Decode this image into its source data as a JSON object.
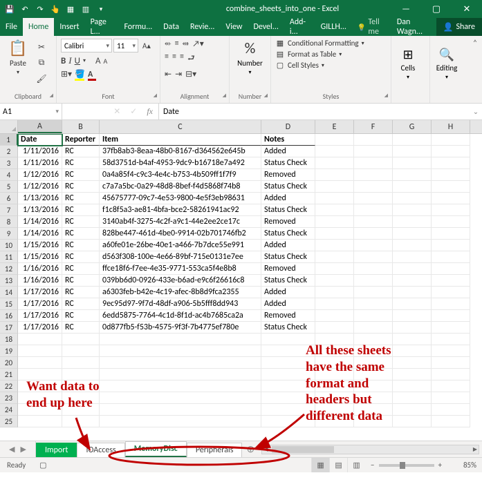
{
  "window": {
    "title": "combine_sheets_into_one - Excel",
    "user": "Dan Wagn...",
    "share_label": "Share"
  },
  "ribbon_tabs": [
    "File",
    "Home",
    "Insert",
    "Page L...",
    "Formu...",
    "Data",
    "Revie...",
    "View",
    "Devel...",
    "Add-i...",
    "GILLH..."
  ],
  "tell_me": "Tell me",
  "ribbon": {
    "paste": "Paste",
    "clipboard_label": "Clipboard",
    "font_name": "Calibri",
    "font_size": "11",
    "font_label": "Font",
    "alignment_label": "Alignment",
    "number": "Number",
    "number_label": "Number",
    "cond_fmt": "Conditional Formatting",
    "fmt_table": "Format as Table",
    "cell_styles": "Cell Styles",
    "styles_label": "Styles",
    "cells": "Cells",
    "editing": "Editing"
  },
  "namebox": "A1",
  "formula": "Date",
  "columns": [
    "A",
    "B",
    "C",
    "D",
    "E",
    "F",
    "G",
    "H"
  ],
  "headers": {
    "A": "Date",
    "B": "Reporter",
    "C": "Item",
    "D": "Notes"
  },
  "rows": [
    {
      "n": 2,
      "A": "1/11/2016",
      "B": "RC",
      "C": "37fb8ab3-8eaa-48b0-8167-d364562e645b",
      "D": "Added"
    },
    {
      "n": 3,
      "A": "1/11/2016",
      "B": "RC",
      "C": "58d3751d-b4af-4953-9dc9-b16718e7a492",
      "D": "Status Check"
    },
    {
      "n": 4,
      "A": "1/12/2016",
      "B": "RC",
      "C": "0a4a85f4-c9c3-4e4c-b753-4b509ff1f7f9",
      "D": "Removed"
    },
    {
      "n": 5,
      "A": "1/12/2016",
      "B": "RC",
      "C": "c7a7a5bc-0a29-48d8-8bef-f4d5868f74b8",
      "D": "Status Check"
    },
    {
      "n": 6,
      "A": "1/13/2016",
      "B": "RC",
      "C": "45675777-09c7-4e53-9800-4e5f3eb98631",
      "D": "Added"
    },
    {
      "n": 7,
      "A": "1/13/2016",
      "B": "RC",
      "C": "f1c8f5a3-ae81-4bfa-bce2-58261941ac92",
      "D": "Status Check"
    },
    {
      "n": 8,
      "A": "1/14/2016",
      "B": "RC",
      "C": "3140ab4f-3275-4c2f-a9c1-44e2ee2ce17c",
      "D": "Removed"
    },
    {
      "n": 9,
      "A": "1/14/2016",
      "B": "RC",
      "C": "828be447-461d-4be0-9914-02b701746fb2",
      "D": "Status Check"
    },
    {
      "n": 10,
      "A": "1/15/2016",
      "B": "RC",
      "C": "a60fe01e-26be-40e1-a466-7b7dce55e991",
      "D": "Added"
    },
    {
      "n": 11,
      "A": "1/15/2016",
      "B": "RC",
      "C": "d563f308-100e-4e66-89bf-715e0131e7ee",
      "D": "Status Check"
    },
    {
      "n": 12,
      "A": "1/16/2016",
      "B": "RC",
      "C": "ffce18f6-f7ee-4e35-9771-553ca5f4e8b8",
      "D": "Removed"
    },
    {
      "n": 13,
      "A": "1/16/2016",
      "B": "RC",
      "C": "039bb6d0-0926-433e-b6ad-e9c6f26616c8",
      "D": "Status Check"
    },
    {
      "n": 14,
      "A": "1/17/2016",
      "B": "RC",
      "C": "a6303feb-b42e-4c19-afec-8b8d9fca2355",
      "D": "Added"
    },
    {
      "n": 15,
      "A": "1/17/2016",
      "B": "RC",
      "C": "9ec95d97-9f7d-48df-a906-5b5fff8dd943",
      "D": "Added"
    },
    {
      "n": 16,
      "A": "1/17/2016",
      "B": "RC",
      "C": "6edd5875-7764-4c1d-8f1d-ac4b7685ca2a",
      "D": "Removed"
    },
    {
      "n": 17,
      "A": "1/17/2016",
      "B": "RC",
      "C": "0d877fb5-f53b-4575-9f3f-7b4775ef780e",
      "D": "Status Check"
    }
  ],
  "empty_rows": [
    18,
    19,
    20,
    21,
    22,
    23,
    24,
    25
  ],
  "sheets": [
    "Import",
    "IOAccess",
    "MemoryDisc",
    "Peripherals"
  ],
  "active_sheet": "MemoryDisc",
  "status": {
    "ready": "Ready",
    "zoom": "85%"
  },
  "annotations": {
    "a1": "Want data to\nend up here",
    "a2": "All these sheets\nhave the same\nformat and\nheaders but\ndifferent data"
  }
}
